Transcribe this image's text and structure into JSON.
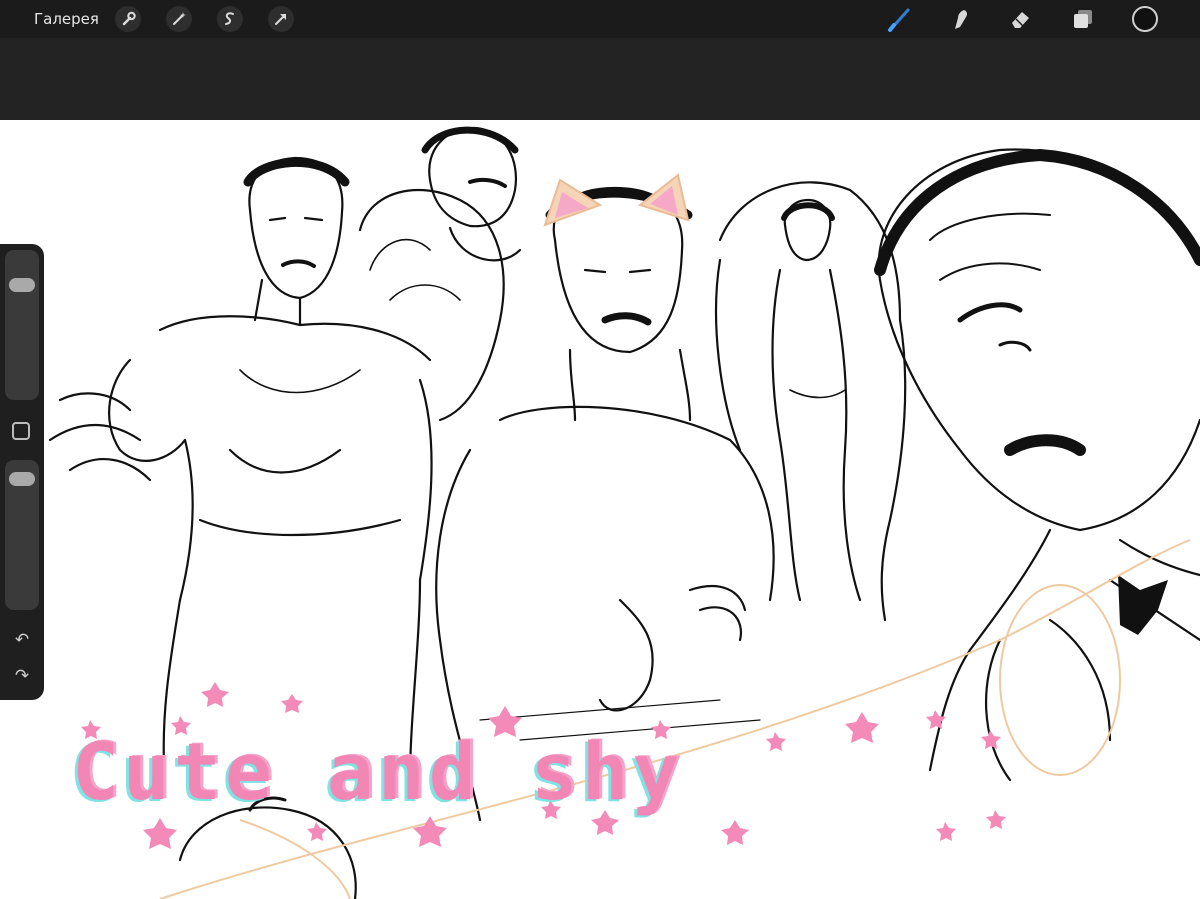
{
  "app": {
    "gallery_label": "Галерея",
    "accent_color": "#2f7fd8",
    "bar_color": "#1b1b1b",
    "left_tools": [
      "wrench-icon",
      "magic-wand-icon",
      "selection-icon",
      "transform-arrow-icon"
    ],
    "right_tools": [
      "brush-icon",
      "smudge-icon",
      "eraser-icon",
      "layers-icon",
      "color-swatch"
    ]
  },
  "sidebar": {
    "brush_size": 0.81,
    "opacity": 0.94,
    "modify_icon": "square-icon",
    "undo_icon": "undo-icon",
    "redo_icon": "redo-icon"
  },
  "canvas": {
    "overlay_text": "Cute and shy",
    "overlay_colors": [
      "#f287b6",
      "#7fe3e3"
    ],
    "sticker": "cat-ears-filter"
  }
}
